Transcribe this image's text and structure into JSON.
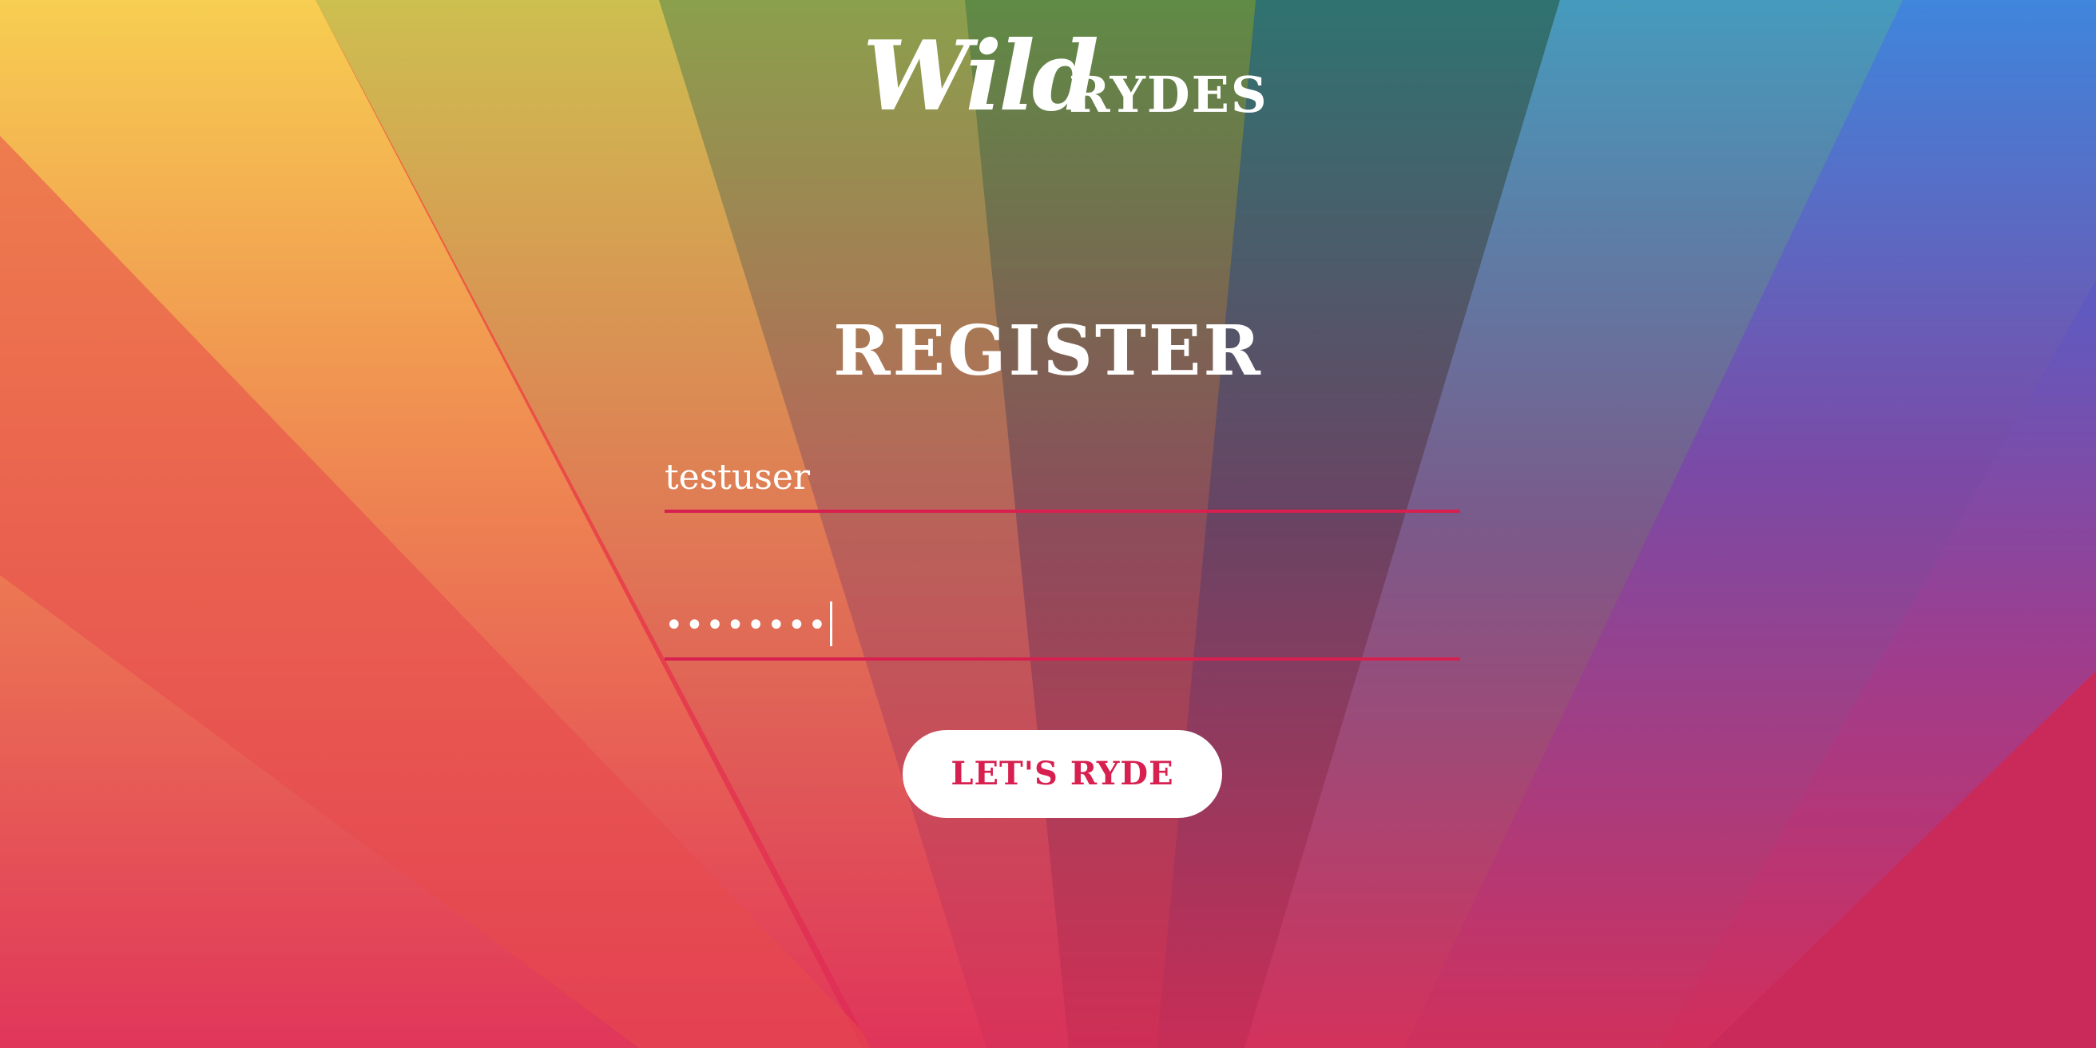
{
  "brand": {
    "logo_script": "Wild",
    "logo_caps": "RYDES"
  },
  "page": {
    "title": "REGISTER"
  },
  "form": {
    "username": {
      "value": "testuser"
    },
    "password": {
      "masked_value": "••••••••"
    },
    "submit_label": "LET'S RYDE"
  },
  "colors": {
    "accent": "#d7204f",
    "text": "#ffffff",
    "button_bg": "#ffffff"
  }
}
